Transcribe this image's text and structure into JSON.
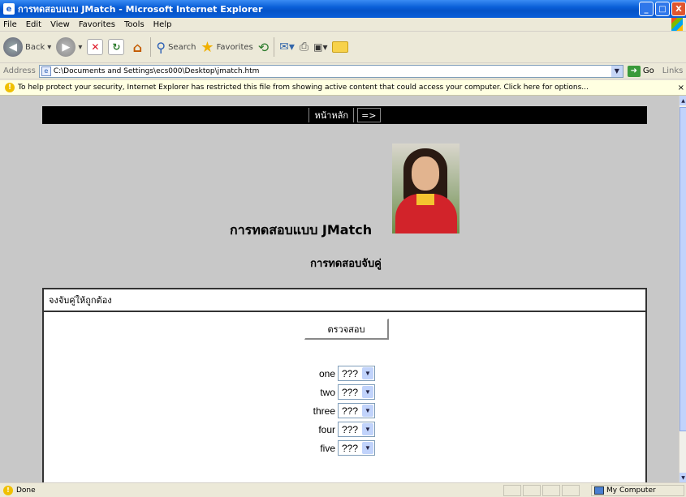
{
  "window": {
    "title": "การทดสอบแบบ JMatch - Microsoft Internet Explorer",
    "controls": {
      "minimize": "_",
      "maximize": "□",
      "close": "X"
    }
  },
  "menu": [
    "File",
    "Edit",
    "View",
    "Favorites",
    "Tools",
    "Help"
  ],
  "toolbar": {
    "back_label": "Back",
    "search_label": "Search",
    "favorites_label": "Favorites"
  },
  "address": {
    "label": "Address",
    "url": "C:\\Documents and Settings\\ecs000\\Desktop\\jmatch.htm",
    "go_label": "Go",
    "links_label": "Links"
  },
  "infobar": {
    "message": "To help protect your security, Internet Explorer has restricted this file from showing active content that could access your computer. Click here for options..."
  },
  "page": {
    "nav_home": "หน้าหลัก",
    "nav_next": "=>",
    "title": "การทดสอบแบบ JMatch",
    "subtitle": "การทดสอบจับคู่",
    "instruction": "จงจับคู่ให้ถูกต้อง",
    "check_button": "ตรวจสอบ",
    "match_items": [
      {
        "label": "one",
        "value": "???"
      },
      {
        "label": "two",
        "value": "???"
      },
      {
        "label": "three",
        "value": "???"
      },
      {
        "label": "four",
        "value": "???"
      },
      {
        "label": "five",
        "value": "???"
      }
    ]
  },
  "status": {
    "text": "Done",
    "zone": "My Computer"
  }
}
